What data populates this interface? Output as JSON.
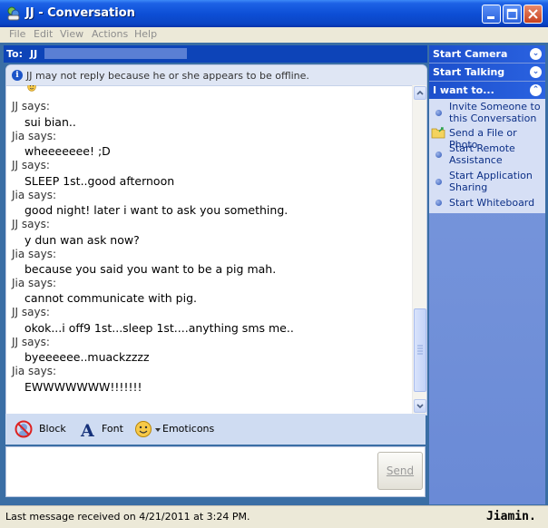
{
  "window": {
    "title": "JJ - Conversation"
  },
  "menu": [
    "File",
    "Edit",
    "View",
    "Actions",
    "Help"
  ],
  "to_bar": {
    "label": "To:",
    "name": "JJ"
  },
  "notice": "JJ may not reply because he or she appears to be offline.",
  "messages": [
    {
      "sender": "JJ says:",
      "text": "sui bian.."
    },
    {
      "sender": "Jia says:",
      "text": "wheeeeeee! ;D"
    },
    {
      "sender": "JJ says:",
      "text": "SLEEP 1st..good afternoon"
    },
    {
      "sender": "Jia says:",
      "text": "good night! later i want to ask you something."
    },
    {
      "sender": "JJ says:",
      "text": "y dun wan ask now?"
    },
    {
      "sender": "Jia says:",
      "text": "because you said you want to be a pig mah."
    },
    {
      "sender": "Jia says:",
      "text": "cannot communicate with pig."
    },
    {
      "sender": "JJ says:",
      "text": "okok...i off9 1st...sleep 1st....anything sms me.."
    },
    {
      "sender": "JJ says:",
      "text": "byeeeeee..muackzzzz"
    },
    {
      "sender": "Jia says:",
      "text": "EWWWWWWW!!!!!!!"
    }
  ],
  "toolbar": {
    "block": "Block",
    "font": "Font",
    "emoticons": "Emoticons"
  },
  "send_button": "Send",
  "right_panel": {
    "start_camera": "Start Camera",
    "start_talking": "Start Talking",
    "i_want_to": "I want to...",
    "tasks": [
      "Invite Someone to this Conversation",
      "Send a File or Photo",
      "Start Remote Assistance",
      "Start Application Sharing",
      "Start Whiteboard"
    ]
  },
  "status": {
    "text": "Last message received on 4/21/2011 at 3:24 PM.",
    "signature": "Jiamin."
  },
  "colors": {
    "titlebar": "#0d4fd6",
    "frame": "#3a6ea5",
    "accent": "#1c4fcc"
  }
}
